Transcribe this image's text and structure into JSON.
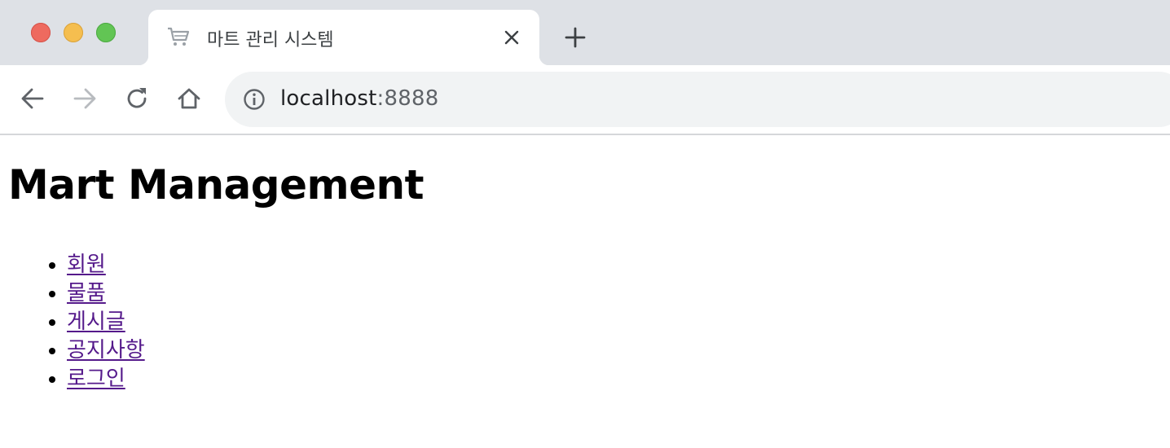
{
  "tab": {
    "title": "마트 관리 시스템",
    "favicon": "shopping-cart-icon"
  },
  "address_bar": {
    "host": "localhost",
    "port": ":8888",
    "icon": "info-icon"
  },
  "page": {
    "heading": "Mart Management",
    "menu_items": [
      {
        "label": "회원"
      },
      {
        "label": "물품"
      },
      {
        "label": "게시글"
      },
      {
        "label": "공지사항"
      },
      {
        "label": "로그인"
      }
    ]
  },
  "colors": {
    "tab_strip": "#dee1e6",
    "omnibox": "#f1f3f4",
    "visited_link": "#551a8b"
  }
}
